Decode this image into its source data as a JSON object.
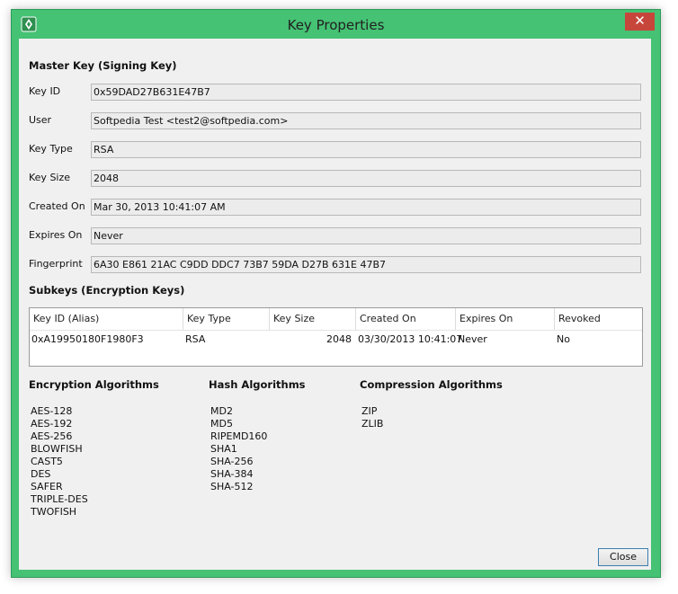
{
  "window": {
    "title": "Key Properties",
    "accent_color": "#45c274",
    "close_glyph": "✕"
  },
  "master": {
    "heading": "Master Key (Signing Key)",
    "fields": [
      {
        "label": "Key ID",
        "value": "0x59DAD27B631E47B7"
      },
      {
        "label": "User",
        "value": "Softpedia Test <test2@softpedia.com>"
      },
      {
        "label": "Key Type",
        "value": "RSA"
      },
      {
        "label": "Key Size",
        "value": "2048"
      },
      {
        "label": "Created On",
        "value": "Mar 30, 2013 10:41:07 AM"
      },
      {
        "label": "Expires On",
        "value": "Never"
      },
      {
        "label": "Fingerprint",
        "value": "6A30 E861 21AC C9DD DDC7 73B7 59DA D27B 631E 47B7"
      }
    ]
  },
  "subkeys": {
    "heading": "Subkeys (Encryption Keys)",
    "columns": [
      "Key ID (Alias)",
      "Key Type",
      "Key Size",
      "Created On",
      "Expires On",
      "Revoked"
    ],
    "rows": [
      [
        "0xA19950180F1980F3",
        "RSA",
        "2048",
        "03/30/2013 10:41:07",
        "Never",
        "No"
      ]
    ]
  },
  "algorithms": {
    "encryption": {
      "heading": "Encryption Algorithms",
      "items": [
        "AES-128",
        "AES-192",
        "AES-256",
        "BLOWFISH",
        "CAST5",
        "DES",
        "SAFER",
        "TRIPLE-DES",
        "TWOFISH"
      ]
    },
    "hash": {
      "heading": "Hash Algorithms",
      "items": [
        "MD2",
        "MD5",
        "RIPEMD160",
        "SHA1",
        "SHA-256",
        "SHA-384",
        "SHA-512"
      ]
    },
    "compression": {
      "heading": "Compression Algorithms",
      "items": [
        "ZIP",
        "ZLIB"
      ]
    }
  },
  "buttons": {
    "close_label": "Close"
  }
}
